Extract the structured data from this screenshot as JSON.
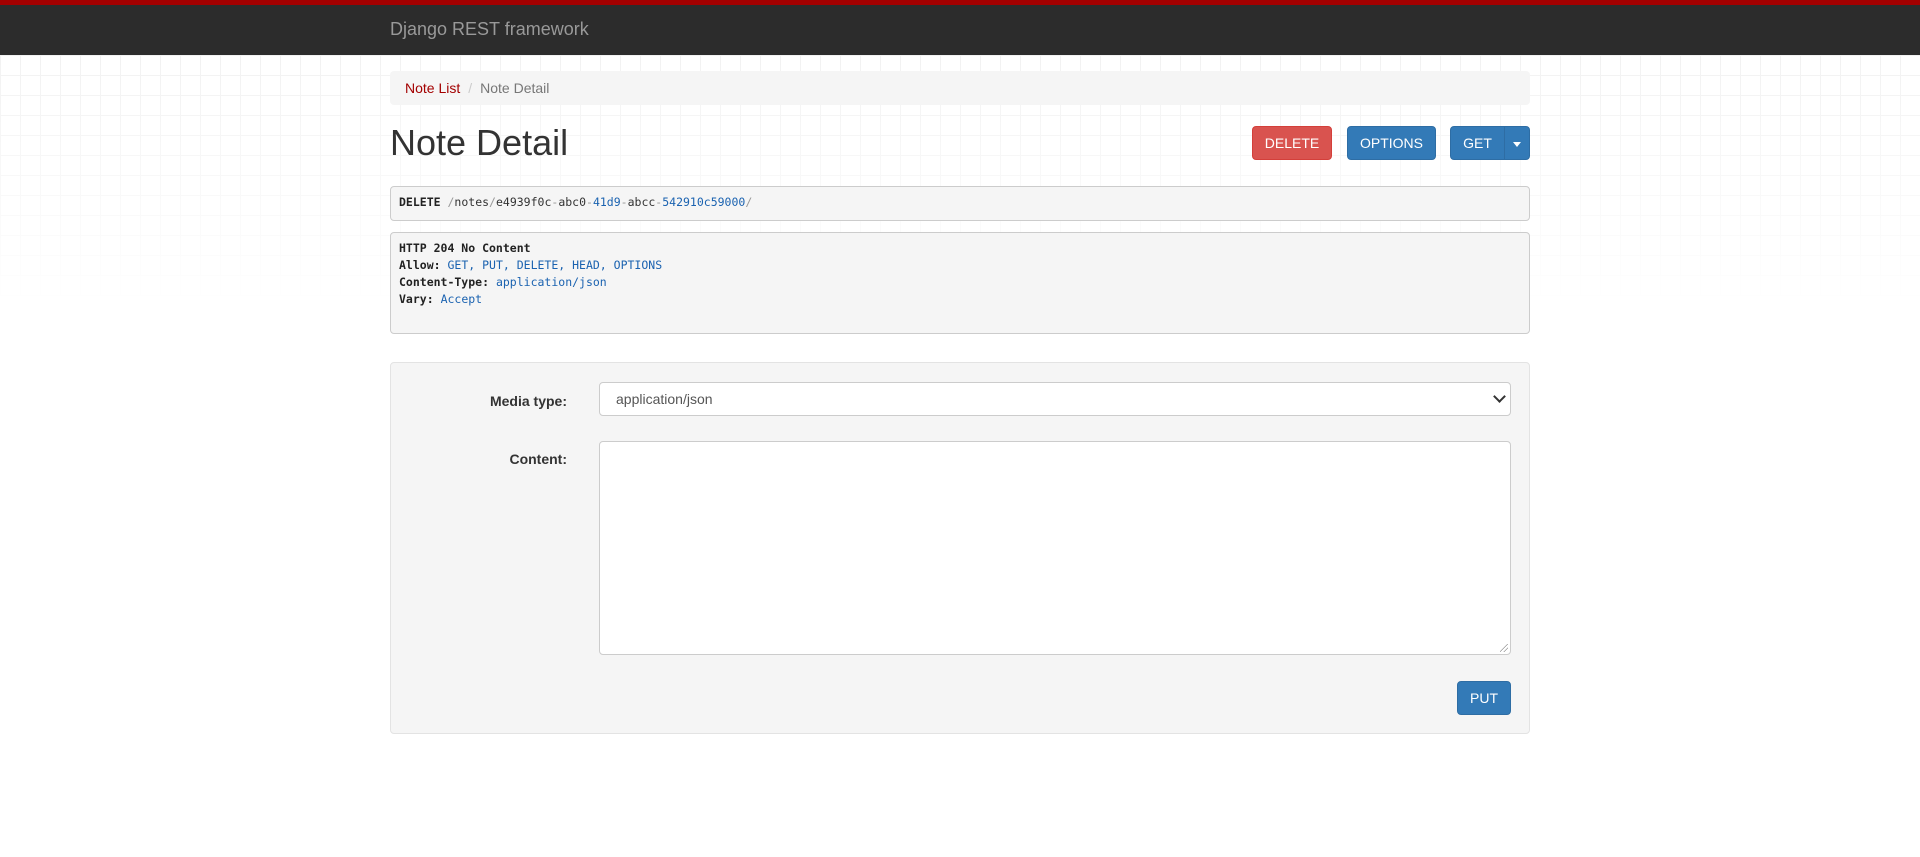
{
  "navbar": {
    "brand": "Django REST framework",
    "accent_color": "#a30000",
    "background_color": "#2c2c2c"
  },
  "breadcrumb": {
    "items": [
      {
        "label": "Note List",
        "link": true
      },
      {
        "label": "Note Detail",
        "link": false
      }
    ],
    "separator": "/"
  },
  "page": {
    "title": "Note Detail"
  },
  "actions": {
    "delete_label": "DELETE",
    "options_label": "OPTIONS",
    "get_label": "GET",
    "get_dropdown_icon": "caret-down-icon"
  },
  "request": {
    "method": "DELETE",
    "path_parts": [
      {
        "text": "/",
        "kind": "lit"
      },
      {
        "text": "notes",
        "kind": "str"
      },
      {
        "text": "/",
        "kind": "lit"
      },
      {
        "text": "e4939f0c",
        "kind": "str"
      },
      {
        "text": "-",
        "kind": "lit"
      },
      {
        "text": "abc0",
        "kind": "str"
      },
      {
        "text": "-",
        "kind": "lit"
      },
      {
        "text": "41d9",
        "kind": "num"
      },
      {
        "text": "-",
        "kind": "lit"
      },
      {
        "text": "abcc",
        "kind": "str"
      },
      {
        "text": "-",
        "kind": "lit"
      },
      {
        "text": "542910c59000",
        "kind": "num"
      },
      {
        "text": "/",
        "kind": "lit"
      }
    ]
  },
  "response": {
    "status": "HTTP 204 No Content",
    "headers": [
      {
        "name": "Allow:",
        "value": "GET, PUT, DELETE, HEAD, OPTIONS"
      },
      {
        "name": "Content-Type:",
        "value": "application/json"
      },
      {
        "name": "Vary:",
        "value": "Accept"
      }
    ]
  },
  "form": {
    "media_type_label": "Media type:",
    "media_type_value": "application/json",
    "content_label": "Content:",
    "content_value": "",
    "put_label": "PUT"
  }
}
